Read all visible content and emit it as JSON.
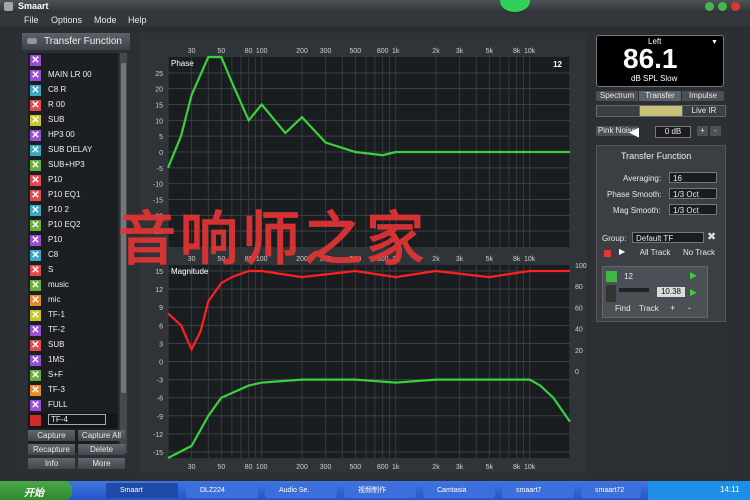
{
  "window": {
    "title": "Smaart"
  },
  "menu": [
    "File",
    "Options",
    "Mode",
    "Help"
  ],
  "left_panel": {
    "title": "Transfer Function",
    "items": [
      {
        "label": "",
        "color": "#9b4fd6"
      },
      {
        "label": "MAIN LR 00",
        "color": "#9b4fd6"
      },
      {
        "label": "C8 R",
        "color": "#3aa6c4"
      },
      {
        "label": "R 00",
        "color": "#e14b4b"
      },
      {
        "label": "SUB",
        "color": "#c9c42a"
      },
      {
        "label": "HP3 00",
        "color": "#9b4fd6"
      },
      {
        "label": "SUB DELAY",
        "color": "#3aa6c4"
      },
      {
        "label": "SUB+HP3",
        "color": "#6aae3a"
      },
      {
        "label": "P10",
        "color": "#e14b4b"
      },
      {
        "label": "P10 EQ1",
        "color": "#e14b4b"
      },
      {
        "label": "P10 2",
        "color": "#3aa6c4"
      },
      {
        "label": "P10 EQ2",
        "color": "#6aae3a"
      },
      {
        "label": "P10",
        "color": "#9b4fd6"
      },
      {
        "label": "C8",
        "color": "#3aa6c4"
      },
      {
        "label": "S",
        "color": "#e14b4b"
      },
      {
        "label": "music",
        "color": "#6aae3a"
      },
      {
        "label": "mic",
        "color": "#e88a2c"
      },
      {
        "label": "TF-1",
        "color": "#c9c42a"
      },
      {
        "label": "TF-2",
        "color": "#9b4fd6"
      },
      {
        "label": "SUB",
        "color": "#e14b4b"
      },
      {
        "label": "1MS",
        "color": "#9b4fd6"
      },
      {
        "label": "S+F",
        "color": "#6aae3a"
      },
      {
        "label": "TF-3",
        "color": "#e88a2c"
      },
      {
        "label": "FULL",
        "color": "#9b4fd6"
      },
      {
        "label": "TF-4",
        "color": "#d22b2b"
      }
    ],
    "buttons": [
      "Capture",
      "Capture All",
      "Recapture",
      "Delete",
      "Info",
      "More"
    ]
  },
  "chart_data": [
    {
      "type": "line",
      "title": "Phase",
      "label_right": "12",
      "ylim": [
        -30,
        30
      ],
      "yticks": [
        25,
        20,
        15,
        10,
        5,
        0,
        -5,
        -10,
        -15,
        -20,
        -25
      ],
      "xticks": [
        "30",
        "50",
        "80",
        "100",
        "200",
        "300",
        "500",
        "800",
        "1k",
        "2k",
        "3k",
        "5k",
        "8k",
        "10k"
      ],
      "series": [
        {
          "color": "#3ad13a",
          "x": [
            20,
            25,
            30,
            40,
            50,
            60,
            80,
            100,
            150,
            200,
            300,
            500,
            800,
            1000,
            2000,
            5000,
            10000,
            20000
          ],
          "y": [
            -5,
            5,
            18,
            30,
            30,
            22,
            10,
            15,
            6,
            11,
            3,
            0,
            -1,
            0,
            0,
            0,
            0,
            0
          ]
        }
      ]
    },
    {
      "type": "line",
      "title": "Magnitude",
      "ylim": [
        -16,
        16
      ],
      "yticks": [
        15,
        12,
        9,
        6,
        3,
        0,
        -3,
        -6,
        -9,
        -12,
        -15
      ],
      "right_ticks": [
        100,
        80,
        60,
        40,
        20,
        0
      ],
      "xticks": [
        "30",
        "50",
        "80",
        "100",
        "200",
        "300",
        "500",
        "800",
        "1k",
        "2k",
        "3k",
        "5k",
        "8k",
        "10k"
      ],
      "series": [
        {
          "color": "#ff2020",
          "x": [
            20,
            25,
            30,
            35,
            40,
            50,
            60,
            80,
            100,
            200,
            500,
            1000,
            2000,
            5000,
            10000,
            20000
          ],
          "y": [
            8,
            6,
            2,
            5,
            10,
            13,
            14,
            15,
            15,
            14,
            15,
            14,
            15,
            14,
            15,
            15
          ]
        },
        {
          "color": "#3ad13a",
          "x": [
            20,
            30,
            40,
            50,
            80,
            100,
            200,
            500,
            1000,
            2000,
            5000,
            10000,
            12000,
            15000,
            20000
          ],
          "y": [
            -24,
            -14,
            -9,
            -6,
            -4,
            -3.5,
            -3,
            -3,
            -3.5,
            -3,
            -3,
            -3,
            -4,
            -6,
            -10
          ]
        }
      ]
    }
  ],
  "right_panel": {
    "spl_label": "Left",
    "spl_value": "86.1",
    "spl_unit": "dB SPL Slow",
    "tabs": [
      "Spectrum",
      "Transfer",
      "Impulse"
    ],
    "live_label": "Live IR",
    "pink_noise": "Pink Noise",
    "db_value": "0 dB",
    "tf_title": "Transfer Function",
    "averaging_label": "Averaging:",
    "averaging_value": "16",
    "phase_smooth_label": "Phase Smooth:",
    "phase_smooth_value": "1/3 Oct",
    "mag_smooth_label": "Mag Smooth:",
    "mag_smooth_value": "1/3 Oct",
    "group_label": "Group:",
    "group_value": "Default TF",
    "all_track": "All Track",
    "no_track": "No Track",
    "track_name": "12",
    "delay_value": "10.38",
    "find_label": "Find",
    "track_label": "Track"
  },
  "taskbar": {
    "start_label": "开始",
    "tasks": [
      "Smaart",
      "DLZ224",
      "Audio Se.",
      "视频制作",
      "Camtasia",
      "smaart7",
      "smaart72"
    ],
    "clock": "14:11"
  },
  "watermark": "音响师之家"
}
